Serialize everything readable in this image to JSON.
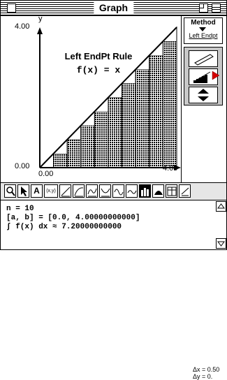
{
  "window": {
    "title": "Graph"
  },
  "plot": {
    "title": "Left EndPt Rule",
    "function": "f(x) = x",
    "y_axis_label": "y",
    "x_axis_label": "x",
    "y_max_label": "4.00",
    "y_min_label": "0.00",
    "x_min_label": "0.00",
    "x_max_label": "4.00"
  },
  "method": {
    "title": "Method",
    "value": "Left Endpt"
  },
  "toolbar": {
    "tools": [
      "zoom-icon",
      "arrow-pointer-icon",
      "text-tool-icon",
      "point-tool-icon",
      "line-tool-icon",
      "curve-tool-icon",
      "wave-tool-icon",
      "tangent-tool-icon",
      "sine-tool-icon",
      "riemann-sum-icon",
      "area-tool-icon",
      "table-tool-icon"
    ],
    "point_label": "(x,y)",
    "dx_label": "Δx = 0.50",
    "dy_label": "Δy = 0."
  },
  "output": {
    "line1": "n = 10",
    "line2": "[a, b] = [0.0, 4.00000000000]",
    "line3": "∫ f(x) dx ≈ 7.20000000000"
  },
  "chart_data": {
    "type": "bar",
    "function": "f(x) = x",
    "method": "left endpoint",
    "n": 10,
    "interval": [
      0,
      4
    ],
    "x": [
      0.0,
      0.4,
      0.8,
      1.2,
      1.6,
      2.0,
      2.4,
      2.8,
      3.2,
      3.6
    ],
    "values": [
      0.0,
      0.4,
      0.8,
      1.2,
      1.6,
      2.0,
      2.4,
      2.8,
      3.2,
      3.6
    ],
    "xlim": [
      0,
      4
    ],
    "ylim": [
      0,
      4
    ],
    "xlabel": "x",
    "ylabel": "y"
  }
}
